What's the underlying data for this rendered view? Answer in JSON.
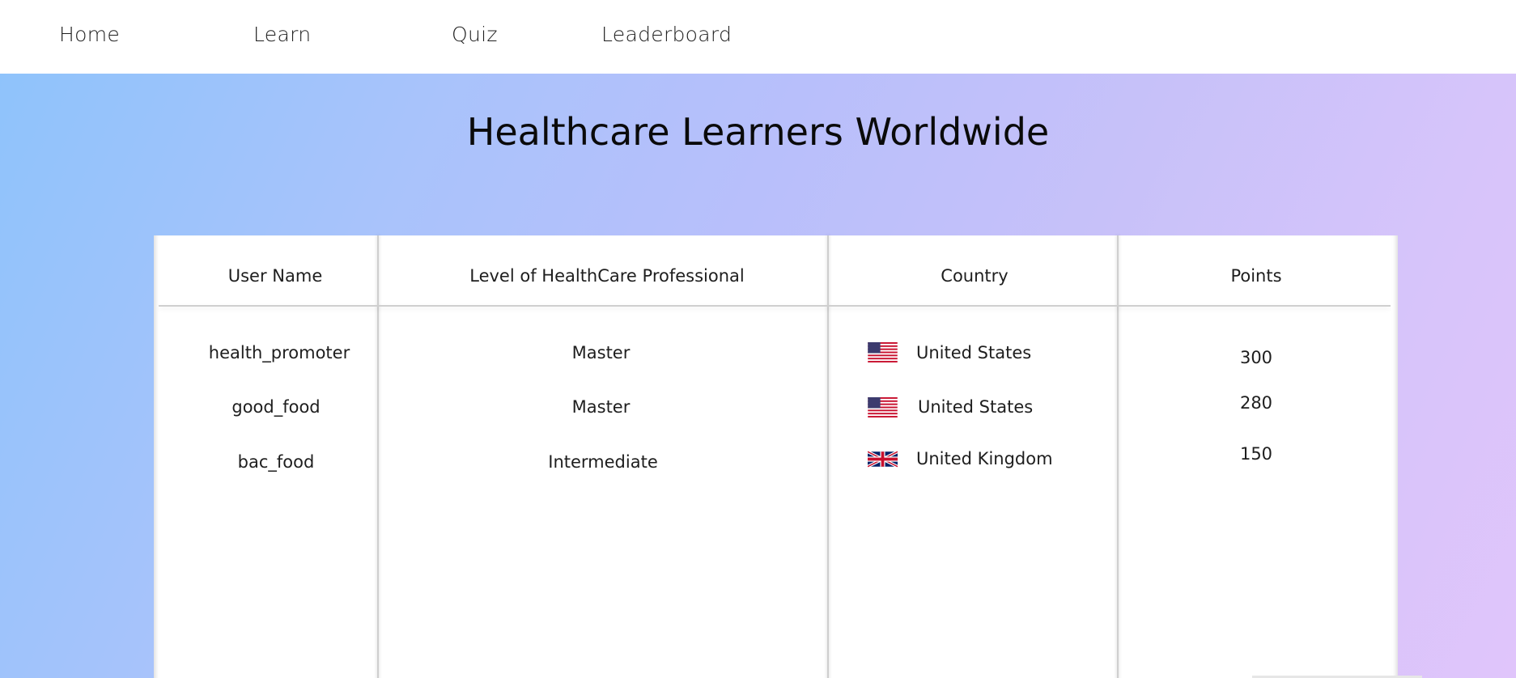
{
  "nav": {
    "items": [
      {
        "label": "Home"
      },
      {
        "label": "Learn"
      },
      {
        "label": "Quiz"
      },
      {
        "label": "Leaderboard"
      }
    ]
  },
  "page": {
    "title": "Healthcare Learners Worldwide"
  },
  "table": {
    "headers": [
      "User Name",
      "Level of HealthCare Professional",
      "Country",
      "Points"
    ],
    "rows": [
      {
        "user": "health_promoter",
        "level": "Master",
        "country": "United States",
        "flag": "us-flag-icon",
        "points": "300"
      },
      {
        "user": "good_food",
        "level": "Master",
        "country": "United States",
        "flag": "us-flag-icon",
        "points": "280"
      },
      {
        "user": "bac_food",
        "level": "Intermediate",
        "country": "United Kingdom",
        "flag": "uk-flag-icon",
        "points": "150"
      }
    ]
  },
  "colors": {
    "gradient_start": "#8fc3fb",
    "gradient_end": "#e0c5fb",
    "flag_red": "#c8102e",
    "flag_blue": "#012169"
  }
}
